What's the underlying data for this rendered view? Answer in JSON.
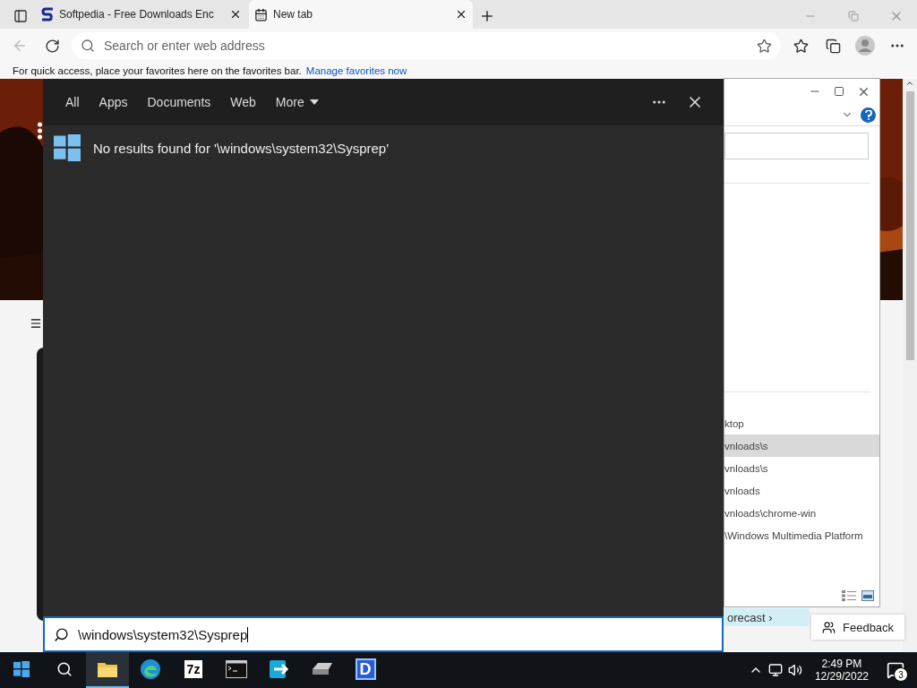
{
  "browser": {
    "tabs": [
      {
        "title": "Softpedia - Free Downloads Enc",
        "selected": false
      },
      {
        "title": "New tab",
        "selected": true
      }
    ],
    "address_bar": {
      "placeholder": "Search or enter web address"
    },
    "favorites_bar": {
      "text": "For quick access, place your favorites here on the favorites bar.",
      "link": "Manage favorites now"
    },
    "page": {
      "forecast_link": "orecast ›",
      "feedback_button": "Feedback"
    }
  },
  "dialog": {
    "items": [
      {
        "text": "ktop",
        "selected": false
      },
      {
        "text": "vnloads\\s",
        "selected": true
      },
      {
        "text": "vnloads\\s",
        "selected": false
      },
      {
        "text": "vnloads",
        "selected": false
      },
      {
        "text": "vnloads\\chrome-win",
        "selected": false
      },
      {
        "text": "\\Windows Multimedia Platform",
        "selected": false
      }
    ]
  },
  "search": {
    "tabs": [
      {
        "label": "All",
        "kind": "plain"
      },
      {
        "label": "Apps",
        "kind": "plain"
      },
      {
        "label": "Documents",
        "kind": "plain"
      },
      {
        "label": "Web",
        "kind": "plain"
      },
      {
        "label": "More",
        "kind": "menu"
      }
    ],
    "result": "No results found for '\\windows\\system32\\Sysprep'",
    "query": "\\windows\\system32\\Sysprep"
  },
  "taskbar": {
    "apps": [
      {
        "kind": "explorer",
        "active": true
      },
      {
        "kind": "edge",
        "active": false
      },
      {
        "kind": "text",
        "label": "7z",
        "active": false
      },
      {
        "kind": "terminal",
        "active": false
      },
      {
        "kind": "transfer",
        "active": false
      },
      {
        "kind": "drive",
        "active": false
      },
      {
        "kind": "badge",
        "label": "D",
        "active": false
      }
    ],
    "time": "2:49 PM",
    "date": "12/29/2022",
    "notifications": "3"
  }
}
